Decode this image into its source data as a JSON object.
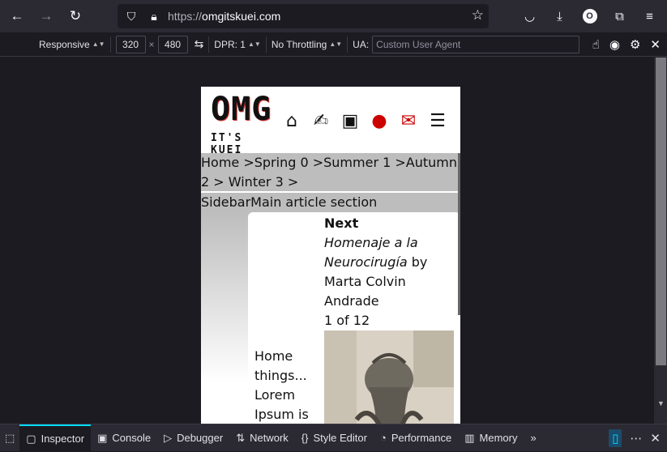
{
  "browser": {
    "url_proto": "https://",
    "url_host": "omgitskuei.com",
    "profile_initial": "O"
  },
  "rdm": {
    "device": "Responsive",
    "width": "320",
    "height": "480",
    "dpr": "DPR: 1",
    "throttling": "No Throttling",
    "ua_label": "UA:",
    "ua_placeholder": "Custom User Agent"
  },
  "site": {
    "logo_big": "OMG",
    "logo_small": "IT'S KUEI",
    "breadcrumb": "Home >Spring 0 >Summer 1 >Autumn 2 > Winter 3 >",
    "sidebar_main": "SidebarMain article section",
    "card": {
      "next_label": "Next",
      "title": "Homenaje a la Neurocirugía",
      "by": " by Marta Colvin Andrade",
      "counter": "1 of 12",
      "left_text": "Home things... Lorem Ipsum is"
    }
  },
  "devtools": {
    "tabs": [
      "Inspector",
      "Console",
      "Debugger",
      "Network",
      "Style Editor",
      "Performance",
      "Memory"
    ]
  }
}
